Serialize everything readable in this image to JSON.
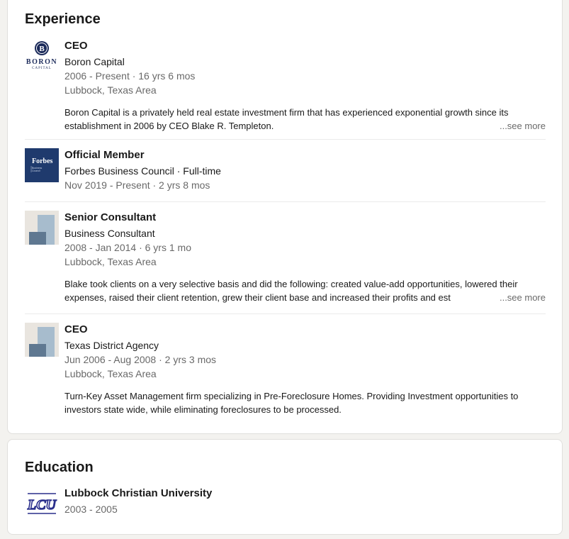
{
  "experience": {
    "title": "Experience",
    "entries": [
      {
        "role": "CEO",
        "company": "Boron Capital",
        "dates": "2006 - Present · 16 yrs 6 mos",
        "location": "Lubbock, Texas Area",
        "description": "Boron Capital is a privately held real estate investment firm that has experienced exponential growth since its establishment in 2006 by CEO Blake R. Templeton.",
        "see_more": "...see more",
        "logo": {
          "name": "boron-capital-logo",
          "line1": "BORON",
          "line2": "CAPITAL",
          "monogram": "B"
        }
      },
      {
        "role": "Official Member",
        "company": "Forbes Business Council · Full-time",
        "dates": "Nov 2019 - Present · 2 yrs 8 mos",
        "logo": {
          "name": "forbes-council-logo",
          "line1": "Forbes",
          "line2": "Business",
          "line3": "Council"
        }
      },
      {
        "role": "Senior Consultant",
        "company": "Business Consultant",
        "dates": "2008 - Jan 2014 · 6 yrs 1 mo",
        "location": "Lubbock, Texas Area",
        "description": "Blake took clients on a very selective basis and did the following: created value-add opportunities, lowered their expenses, raised their client retention, grew their client base and increased their profits and est",
        "see_more": "...see more",
        "logo": {
          "name": "company-placeholder-logo"
        }
      },
      {
        "role": "CEO",
        "company": "Texas District Agency",
        "dates": "Jun 2006 - Aug 2008 · 2 yrs 3 mos",
        "location": "Lubbock, Texas Area",
        "description": "Turn-Key Asset Management firm specializing in Pre-Foreclosure Homes. Providing Investment opportunities to investors state wide, while eliminating foreclosures to be processed.",
        "logo": {
          "name": "company-placeholder-logo"
        }
      }
    ]
  },
  "education": {
    "title": "Education",
    "entries": [
      {
        "school": "Lubbock Christian University",
        "dates": "2003 - 2005",
        "logo": {
          "name": "lcu-logo",
          "text": "LCU"
        }
      }
    ]
  },
  "colors": {
    "forbes_navy": "#1f3a6d",
    "placeholder_light": "#a7bccd",
    "placeholder_dark": "#5f7891",
    "placeholder_bg": "#e9e5df",
    "lcu_blue": "#2a2f8c"
  }
}
